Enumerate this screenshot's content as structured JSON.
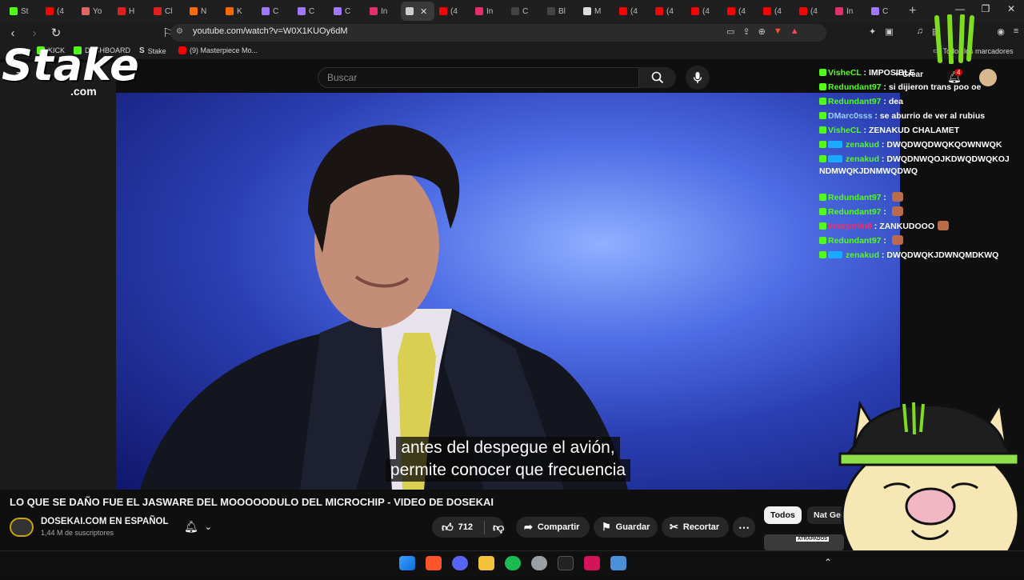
{
  "browser": {
    "tabs": [
      {
        "label": "St",
        "color": "#53fc18"
      },
      {
        "label": "(4",
        "color": "#ff0000"
      },
      {
        "label": "Yo",
        "color": "#e06666"
      },
      {
        "label": "H",
        "color": "#e02020"
      },
      {
        "label": "Cl",
        "color": "#e02020"
      },
      {
        "label": "N",
        "color": "#ff6a00"
      },
      {
        "label": "K",
        "color": "#ff6a00"
      },
      {
        "label": "C",
        "color": "#a277ff"
      },
      {
        "label": "C",
        "color": "#a277ff"
      },
      {
        "label": "C",
        "color": "#a277ff"
      },
      {
        "label": "In",
        "color": "#e1306c"
      },
      {
        "label": "",
        "color": "#cccccc"
      },
      {
        "label": "(4",
        "color": "#ff0000"
      },
      {
        "label": "In",
        "color": "#e1306c"
      },
      {
        "label": "C",
        "color": "#444444"
      },
      {
        "label": "Bl",
        "color": "#444444"
      },
      {
        "label": "M",
        "color": "#dddddd"
      },
      {
        "label": "(4",
        "color": "#ff0000"
      },
      {
        "label": "(4",
        "color": "#ff0000"
      },
      {
        "label": "(4",
        "color": "#ff0000"
      },
      {
        "label": "(4",
        "color": "#ff0000"
      },
      {
        "label": "(4",
        "color": "#ff0000"
      },
      {
        "label": "(4",
        "color": "#ff0000"
      },
      {
        "label": "In",
        "color": "#e1306c"
      },
      {
        "label": "C",
        "color": "#a277ff"
      }
    ],
    "active_tab_index": 11,
    "url": "youtube.com/watch?v=W0X1KUOy6dM",
    "bookmarks": [
      {
        "label": "KICK"
      },
      {
        "label": "DASHBOARD"
      },
      {
        "label": "Stake"
      },
      {
        "label": "(9) Masterpiece Mo..."
      }
    ],
    "all_bookmarks_label": "Todos los marcadores"
  },
  "overlay": {
    "stake_logo": "Stake",
    "stake_sub": ".com"
  },
  "youtube": {
    "search_placeholder": "Buscar",
    "create_label": "Crear",
    "notif_count": "4",
    "subtitles": [
      "antes del despegue el avión,",
      "permite conocer que frecuencia"
    ],
    "video_title": "LO QUE SE DAÑO FUE EL JASWARE DEL MOOOOODULO DEL MICROCHIP - VIDEO DE DOSEKAI",
    "channel_name": "DOSEKAI.COM EN ESPAÑOL",
    "channel_subs": "1,44 M de suscriptores",
    "likes": "712",
    "share_label": "Compartir",
    "save_label": "Guardar",
    "clip_label": "Recortar",
    "chips": [
      "Todos",
      "Nat Geo"
    ],
    "thumb_text": "ATRAPADOS"
  },
  "chat": [
    {
      "user": "VisheCL",
      "text": "IMPOSIBLE",
      "style": "u"
    },
    {
      "user": "Redundant97",
      "text": "si dijieron trans poo oe",
      "style": "u"
    },
    {
      "user": "Redundant97",
      "text": "dea",
      "style": "u"
    },
    {
      "user": "DMarc0sss",
      "text": "se aburrio de ver al rubius",
      "style": "u2"
    },
    {
      "user": "VisheCL",
      "text": "ZENAKUD CHALAMET",
      "style": "u"
    },
    {
      "user": "zenakud",
      "text": "DWQDWQDWQKQOWNWQK",
      "style": "u"
    },
    {
      "user": "zenakud",
      "text": "DWQDNWQOJKDWQDWQKOJNDMWQKJDNMWQDWQ",
      "style": "u"
    },
    {
      "user": "Redundant97",
      "text": "",
      "style": "u"
    },
    {
      "user": "Redundant97",
      "text": "",
      "style": "u"
    },
    {
      "user": "Instrptr0n8",
      "text": "ZANKUDOOO",
      "style": "u3"
    },
    {
      "user": "Redundant97",
      "text": "",
      "style": "u"
    },
    {
      "user": "zenakud",
      "text": "DWQDWQKJDWNQMDKWQ",
      "style": "u"
    }
  ],
  "colors": {
    "kick_green": "#53fc18",
    "youtube_bg": "#0f0f0f"
  }
}
